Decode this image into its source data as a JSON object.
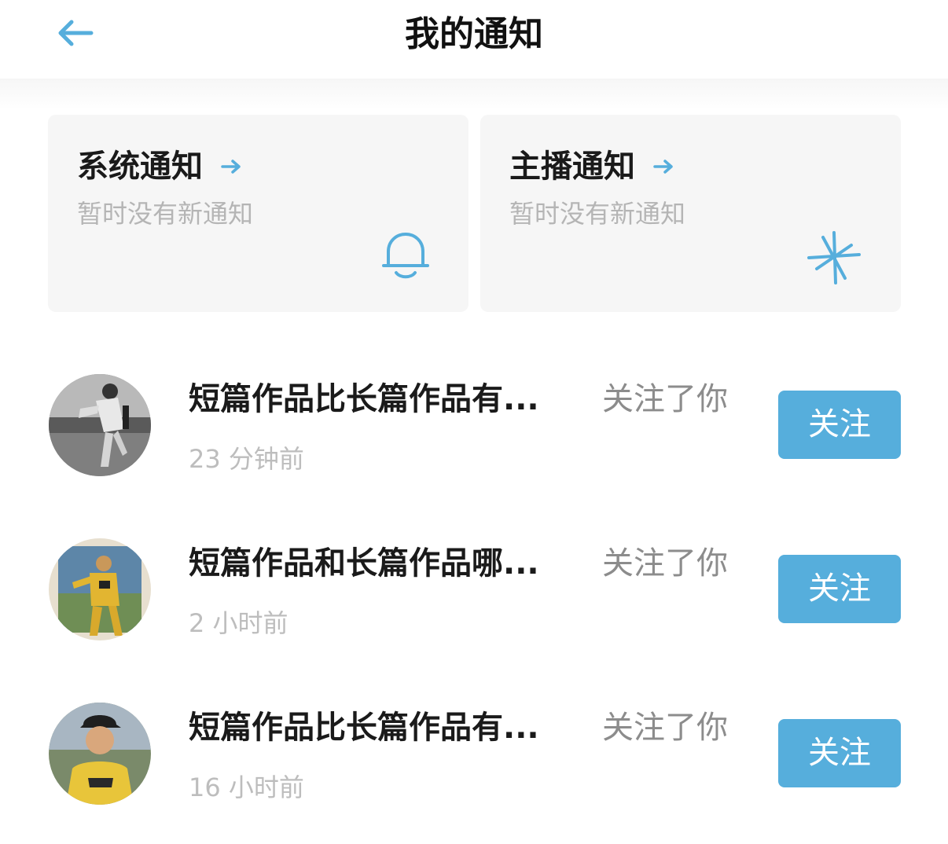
{
  "header": {
    "title": "我的通知",
    "back_icon": "arrow-left-icon",
    "accent_color": "#56aedc"
  },
  "cards": [
    {
      "title": "系统通知",
      "subtitle": "暂时没有新通知",
      "icon": "bell-icon"
    },
    {
      "title": "主播通知",
      "subtitle": "暂时没有新通知",
      "icon": "sparkle-icon"
    }
  ],
  "notifications": [
    {
      "title": "短篇作品比长篇作品有...",
      "action": "关注了你",
      "time": "23 分钟前",
      "button_label": "关注",
      "avatar": "avatar-photo"
    },
    {
      "title": "短篇作品和长篇作品哪...",
      "action": "关注了你",
      "time": "2 小时前",
      "button_label": "关注",
      "avatar": "avatar-photo"
    },
    {
      "title": "短篇作品比长篇作品有...",
      "action": "关注了你",
      "time": "16 小时前",
      "button_label": "关注",
      "avatar": "avatar-photo"
    }
  ]
}
